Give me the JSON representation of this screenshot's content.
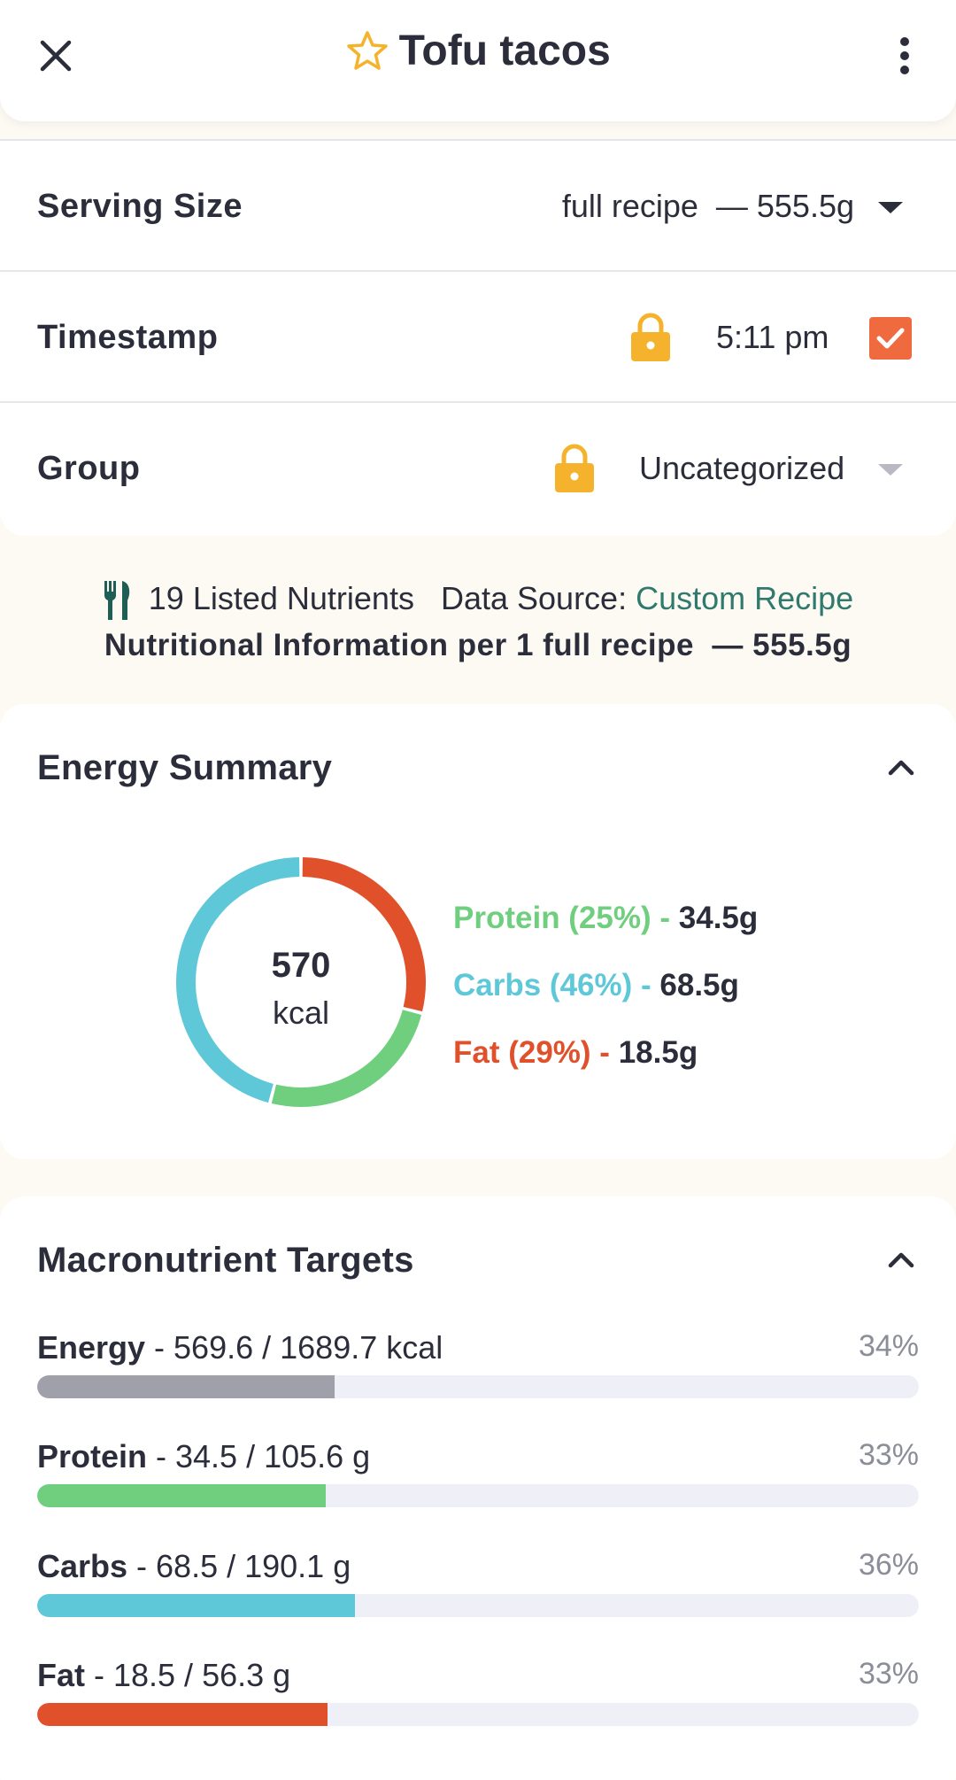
{
  "header": {
    "title": "Tofu tacos",
    "close_icon": "close-icon",
    "favorite_icon": "star-outline-icon",
    "menu_icon": "more-vertical-icon"
  },
  "settings": {
    "serving_size": {
      "label": "Serving Size",
      "value": "full recipe  — 555.5g"
    },
    "timestamp": {
      "label": "Timestamp",
      "value": "5:11 pm",
      "locked": true,
      "checked": true
    },
    "group": {
      "label": "Group",
      "value": "Uncategorized",
      "locked": true
    }
  },
  "info": {
    "nutrients_count": "19 Listed Nutrients",
    "data_source_label": "Data Source:",
    "data_source_value": "Custom Recipe",
    "per_line": "Nutritional Information per 1 full recipe  — 555.5g"
  },
  "energy_summary": {
    "title": "Energy Summary",
    "kcal_value": "570",
    "kcal_unit": "kcal",
    "macros": [
      {
        "label": "Protein (25%) - ",
        "amount": "34.5g",
        "color": "#6fcf7f",
        "percent": 25
      },
      {
        "label": "Carbs (46%) - ",
        "amount": "68.5g",
        "color": "#5ec8d8",
        "percent": 46
      },
      {
        "label": "Fat (29%) - ",
        "amount": "18.5g",
        "color": "#e0512b",
        "percent": 29
      }
    ]
  },
  "targets": {
    "title": "Macronutrient Targets",
    "items": [
      {
        "name": "Energy",
        "detail": " - 569.6 / 1689.7 kcal",
        "percent_label": "34%",
        "fraction": 0.337,
        "color": "#9fa0aa"
      },
      {
        "name": "Protein",
        "detail": " - 34.5 / 105.6 g",
        "percent_label": "33%",
        "fraction": 0.327,
        "color": "#6fcf7f"
      },
      {
        "name": "Carbs",
        "detail": " - 68.5 / 190.1 g",
        "percent_label": "36%",
        "fraction": 0.36,
        "color": "#5ec8d8"
      },
      {
        "name": "Fat",
        "detail": " - 18.5 / 56.3 g",
        "percent_label": "33%",
        "fraction": 0.329,
        "color": "#e0512b"
      }
    ]
  },
  "colors": {
    "accent_orange": "#ef6b3f",
    "lock_yellow": "#f5b32d",
    "link_teal": "#2f7a6c",
    "fork_icon": "#1f5e55"
  }
}
